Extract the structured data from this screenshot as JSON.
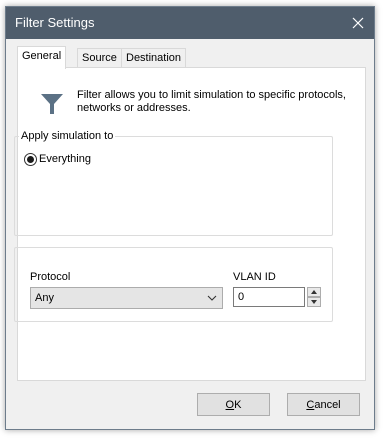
{
  "window": {
    "title": "Filter Settings",
    "close_icon": "close-icon"
  },
  "tabs": [
    {
      "label": "General",
      "active": true
    },
    {
      "label": "Source",
      "active": false
    },
    {
      "label": "Destination",
      "active": false
    }
  ],
  "general": {
    "info_icon": "filter-funnel-icon",
    "info_line1": "Filter allows you to limit simulation to specific protocols,",
    "info_line2": "networks or addresses.",
    "apply_group": {
      "legend": "Apply simulation to",
      "option_label": "Everything",
      "option_selected": true
    },
    "protocol": {
      "label": "Protocol",
      "value": "Any"
    },
    "vlan": {
      "label": "VLAN ID",
      "value": "0"
    }
  },
  "buttons": {
    "ok": {
      "mnemonic": "O",
      "rest": "K"
    },
    "cancel": {
      "mnemonic": "C",
      "rest": "ancel"
    }
  },
  "colors": {
    "titlebar": "#4f5d6c",
    "accent_icon": "#5b7185",
    "dialog_bg": "#f0f0f0"
  }
}
